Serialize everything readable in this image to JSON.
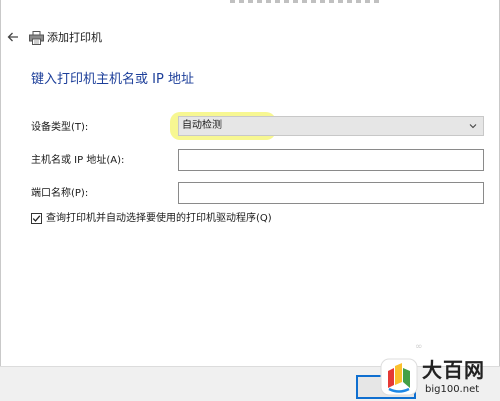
{
  "window": {
    "title": "添加打印机"
  },
  "main": {
    "heading": "键入打印机主机名或 IP 地址"
  },
  "form": {
    "device_type": {
      "label": "设备类型(T):",
      "selected": "自动检测"
    },
    "hostname": {
      "label": "主机名或 IP 地址(A):",
      "value": ""
    },
    "port_name": {
      "label": "端口名称(P):",
      "value": ""
    },
    "query_printer": {
      "label": "查询打印机并自动选择要使用的打印机驱动程序(Q)",
      "checked": true
    }
  },
  "icons": {
    "back": "back-arrow-icon",
    "printer": "printer-icon",
    "dropdown": "chevron-down-icon",
    "checkmark": "checkmark-icon"
  },
  "watermark": {
    "brand": "大百网",
    "url": "big100.net"
  },
  "colors": {
    "heading": "#1d3f9a",
    "highlight": "#f4f46e",
    "button_border": "#0f6fd0"
  }
}
